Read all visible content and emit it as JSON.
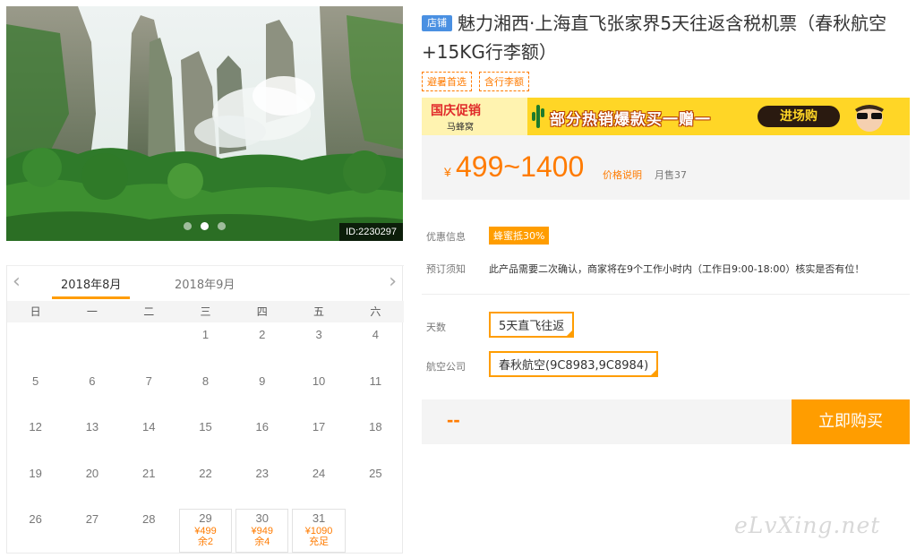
{
  "hero": {
    "image_id": "ID:2230297",
    "slides": 3,
    "active_slide": 2
  },
  "calendar": {
    "prev_arrow": "‹",
    "next_arrow": "›",
    "months": [
      "2018年8月",
      "2018年9月"
    ],
    "active_month": 0,
    "weekdays": [
      "日",
      "一",
      "二",
      "三",
      "四",
      "五",
      "六"
    ],
    "rows": [
      [
        {
          "d": ""
        },
        {
          "d": ""
        },
        {
          "d": ""
        },
        {
          "d": "1"
        },
        {
          "d": "2"
        },
        {
          "d": "3"
        },
        {
          "d": "4"
        }
      ],
      [
        {
          "d": "5"
        },
        {
          "d": "6"
        },
        {
          "d": "7"
        },
        {
          "d": "8"
        },
        {
          "d": "9"
        },
        {
          "d": "10"
        },
        {
          "d": "11"
        }
      ],
      [
        {
          "d": "12"
        },
        {
          "d": "13"
        },
        {
          "d": "14"
        },
        {
          "d": "15"
        },
        {
          "d": "16"
        },
        {
          "d": "17"
        },
        {
          "d": "18"
        }
      ],
      [
        {
          "d": "19"
        },
        {
          "d": "20"
        },
        {
          "d": "21"
        },
        {
          "d": "22"
        },
        {
          "d": "23"
        },
        {
          "d": "24"
        },
        {
          "d": "25"
        }
      ],
      [
        {
          "d": "26"
        },
        {
          "d": "27"
        },
        {
          "d": "28"
        },
        {
          "d": "29",
          "price": "¥499",
          "stock": "余2"
        },
        {
          "d": "30",
          "price": "¥949",
          "stock": "余4"
        },
        {
          "d": "31",
          "price": "¥1090",
          "stock": "充足"
        },
        {
          "d": ""
        }
      ]
    ]
  },
  "product": {
    "shop_badge": "店铺",
    "title": "魅力湘西·上海直飞张家界5天往返含税机票（春秋航空+15KG行李额）",
    "tags": [
      "避暑首选",
      "含行李额"
    ]
  },
  "banner": {
    "left_title": "国庆促销",
    "brand": "马蜂窝",
    "slogan": "部分热销爆款买一赠一",
    "cta": "进场购"
  },
  "price": {
    "currency": "¥",
    "range": "499~1400",
    "explain_link": "价格说明",
    "monthly_sales": "月售37"
  },
  "info": {
    "discount_label": "优惠信息",
    "discount_badge": "蜂蜜抵30%",
    "notice_label": "预订须知",
    "notice_text": "此产品需要二次确认，商家将在9个工作小时内（工作日9:00-18:00）核实是否有位！"
  },
  "options": {
    "days_label": "天数",
    "days_value": "5天直飞往返",
    "airline_label": "航空公司",
    "airline_value": "春秋航空(9C8983,9C8984)"
  },
  "purchase": {
    "total": "--",
    "buy_label": "立即购买"
  },
  "colors": {
    "accent": "#ff9d00",
    "price": "#ff7b00",
    "shop_badge": "#4a90e2",
    "banner": "#ffd626"
  },
  "watermark": "eLvXing.net"
}
